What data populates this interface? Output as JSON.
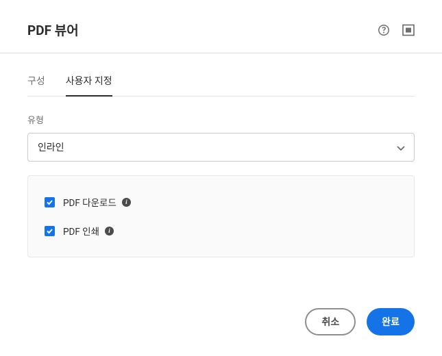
{
  "header": {
    "title": "PDF 뷰어"
  },
  "tabs": [
    {
      "label": "구성",
      "active": false
    },
    {
      "label": "사용자 지정",
      "active": true
    }
  ],
  "form": {
    "type_label": "유형",
    "type_value": "인라인"
  },
  "options": [
    {
      "label": "PDF 다운로드",
      "checked": true
    },
    {
      "label": "PDF 인쇄",
      "checked": true
    }
  ],
  "footer": {
    "cancel": "취소",
    "done": "완료"
  }
}
